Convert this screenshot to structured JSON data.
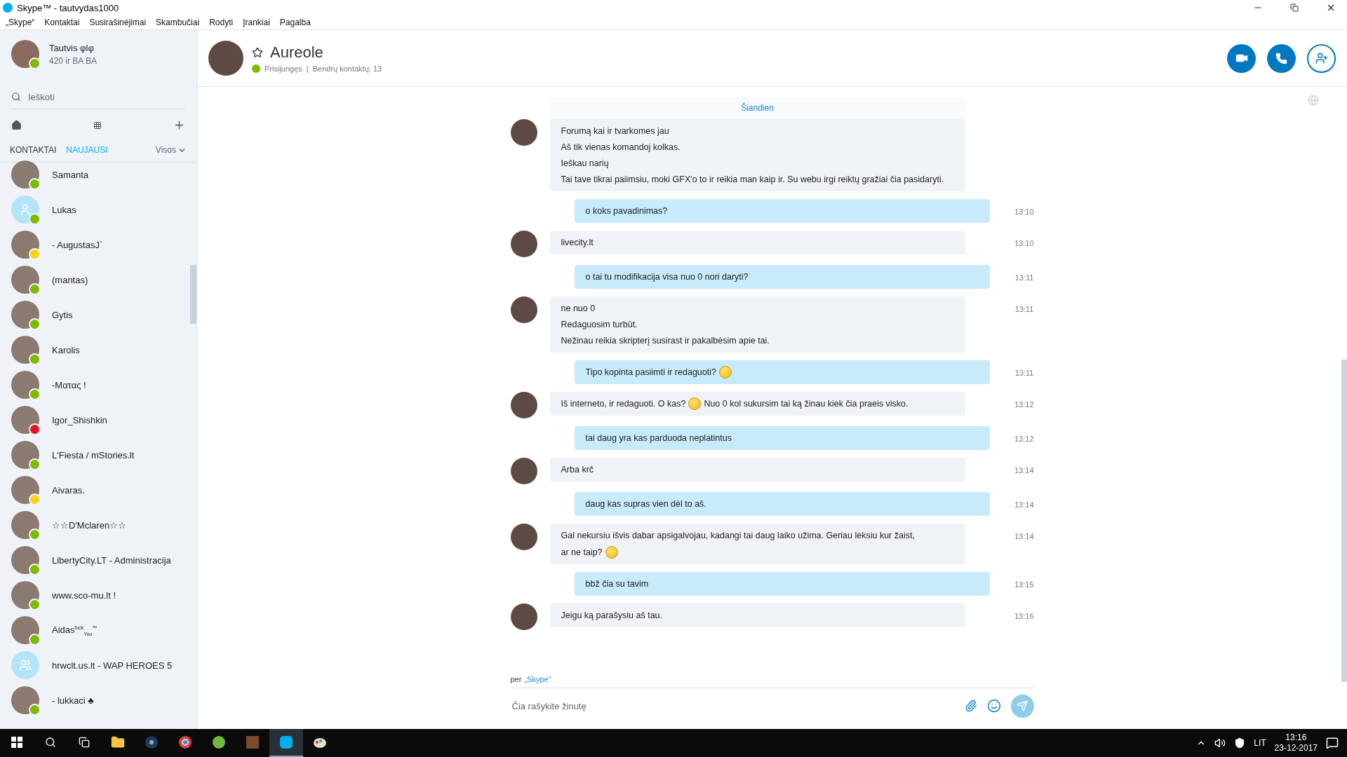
{
  "window": {
    "title": "Skype™ - tautvydas1000"
  },
  "menu": [
    "„Skype“",
    "Kontaktai",
    "Susirašinėjimai",
    "Skambučiai",
    "Rodyti",
    "Įrankiai",
    "Pagalba"
  ],
  "profile": {
    "name": "Tautvis φlφ",
    "mood": "420 ir BA BA",
    "color": "#7fba00"
  },
  "search": {
    "placeholder": "Ieškoti"
  },
  "tabs": [
    {
      "label": "KONTAKTAI",
      "selected": false
    },
    {
      "label": "NAUJAUSI",
      "selected": true
    }
  ],
  "filter": {
    "label": "Visos"
  },
  "contacts": [
    {
      "name": "Samanta",
      "color": "#7fba00",
      "kind": "photo"
    },
    {
      "name": "Lukas",
      "color": "#7fba00",
      "kind": "default"
    },
    {
      "name": "- AugustasJ`",
      "color": "#fcd116",
      "kind": "photo"
    },
    {
      "name": "(mantas)",
      "color": "#7fba00",
      "kind": "photo"
    },
    {
      "name": "Gytis",
      "color": "#7fba00",
      "kind": "photo"
    },
    {
      "name": "Karolis",
      "color": "#7fba00",
      "kind": "photo"
    },
    {
      "name": "-Ματας !",
      "color": "#7fba00",
      "kind": "photo"
    },
    {
      "name": "Igor_Shishkin",
      "color": "#e81123",
      "kind": "photo"
    },
    {
      "name": "L'Fiesta / mStories.lt",
      "color": "#7fba00",
      "kind": "photo"
    },
    {
      "name": "Aivaras.",
      "color": "#fcd116",
      "kind": "photo"
    },
    {
      "name": "☆☆D'Mclaren☆☆",
      "color": "#7fba00",
      "kind": "photo"
    },
    {
      "name": "LibertyCity.LT - Administracija",
      "color": "#7fba00",
      "kind": "photo"
    },
    {
      "name": "www.sco-mu.lt !",
      "color": "#7fba00",
      "kind": "photo"
    },
    {
      "name": "Aidas$^{fuck}$$_{You}$$^{™}$",
      "color": "#7fba00",
      "kind": "photo"
    },
    {
      "name": "hrwclt.us.lt - WAP HEROES 5",
      "kind": "group"
    },
    {
      "name": "- lukkaci ♣",
      "color": "#7fba00",
      "kind": "photo"
    }
  ],
  "chat": {
    "name": "Aureole",
    "status_text": "Prisijungęs",
    "separator": "|",
    "mutual": "Bendrų kontaktų: 13",
    "color": "#7fba00"
  },
  "date_label": "Šiandien",
  "messages": [
    {
      "kind": "in",
      "lines": [
        [
          {
            "kind": "text",
            "text": "Forumą kai ir tvarkomes jau"
          }
        ],
        [
          {
            "kind": "text",
            "text": "Aš tik vienas komandoj kolkas."
          }
        ],
        [
          {
            "kind": "text",
            "text": "Ieškau narių"
          }
        ],
        [
          {
            "kind": "text",
            "text": "Tai tave tikrai paiimsiu, moki GFX'o to ir reikia man kaip ir. Su webu irgi reiktų gražiai čia pasidaryti."
          }
        ]
      ]
    },
    {
      "kind": "out",
      "time": "13:10",
      "lines": [
        [
          {
            "kind": "text",
            "text": "o koks pavadinimas?"
          }
        ]
      ]
    },
    {
      "kind": "in",
      "time": "13:10",
      "lines": [
        [
          {
            "kind": "text",
            "text": "livecity.lt"
          }
        ]
      ]
    },
    {
      "kind": "out",
      "time": "13:11",
      "lines": [
        [
          {
            "kind": "text",
            "text": "o tai tu modifikacija visa nuo 0 nori daryti?"
          }
        ]
      ]
    },
    {
      "kind": "in",
      "time": "13:11",
      "lines": [
        [
          {
            "kind": "text",
            "text": "ne nuo 0"
          }
        ],
        [
          {
            "kind": "text",
            "text": "Redaguosim turbūt."
          }
        ],
        [
          {
            "kind": "text",
            "text": "Nežinau reikia skripterį susirast ir pakalbėsim apie tai."
          }
        ]
      ]
    },
    {
      "kind": "out",
      "time": "13:11",
      "lines": [
        [
          {
            "kind": "text",
            "text": "Tipo kopinta pasiimti ir redaguoti?"
          },
          {
            "kind": "smiley"
          }
        ]
      ]
    },
    {
      "kind": "in",
      "time": "13:12",
      "lines": [
        [
          {
            "kind": "text",
            "text": "Iš interneto, ir redaguoti. O kas?"
          },
          {
            "kind": "smiley"
          },
          {
            "kind": "text",
            "text": "Nuo 0 kol sukursim tai ką žinau kiek čia praeis visko."
          }
        ]
      ]
    },
    {
      "kind": "out",
      "time": "13:12",
      "lines": [
        [
          {
            "kind": "text",
            "text": "tai daug yra kas parduoda neplatintus"
          }
        ]
      ]
    },
    {
      "kind": "in",
      "time": "13:14",
      "lines": [
        [
          {
            "kind": "text",
            "text": "Arba krč"
          }
        ]
      ]
    },
    {
      "kind": "out",
      "time": "13:14",
      "lines": [
        [
          {
            "kind": "text",
            "text": "daug kas supras vien dėl to aš."
          }
        ]
      ]
    },
    {
      "kind": "in",
      "time": "13:14",
      "lines": [
        [
          {
            "kind": "text",
            "text": "Gal nekursiu išvis dabar apsigalvojau, kadangi tai daug laiko užima. Geriau lėksiu kur žaist,"
          },
          {
            "kind": "text",
            "text": "ar ne taip?"
          },
          {
            "kind": "smiley"
          }
        ]
      ]
    },
    {
      "kind": "out",
      "time": "13:15",
      "lines": [
        [
          {
            "kind": "text",
            "text": "bbž čia su tavim"
          }
        ]
      ]
    },
    {
      "kind": "in",
      "time": "13:16",
      "lines": [
        [
          {
            "kind": "text",
            "text": "Jeigu ką parašysiu aš tau."
          }
        ]
      ]
    }
  ],
  "via": {
    "prefix": "per",
    "link": "„Skype“"
  },
  "composer": {
    "placeholder": "Čia rašykite žinutę"
  },
  "taskbar": {
    "apps": [
      {
        "kind": "explorer",
        "selected": false
      },
      {
        "kind": "disc",
        "selected": false
      },
      {
        "kind": "browser",
        "selected": false
      },
      {
        "kind": "torrent",
        "selected": false
      },
      {
        "kind": "game",
        "selected": false
      },
      {
        "kind": "skype",
        "selected": true
      },
      {
        "kind": "paint",
        "selected": false
      }
    ],
    "language": "LIT",
    "time": "13:16",
    "date": "23-12-2017"
  }
}
